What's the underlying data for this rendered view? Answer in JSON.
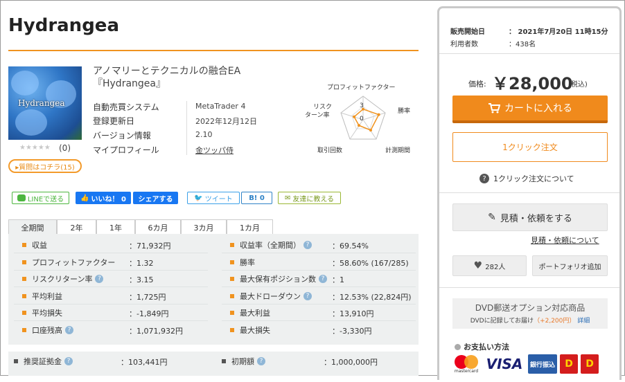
{
  "product": {
    "title": "Hydrangea",
    "thumb_label": "Hydrangea",
    "subtitle_line1": "アノマリーとテクニカルの融合EA",
    "subtitle_line2": "『Hydrangea』",
    "stars": "★★★★★",
    "rating_count": "(0)",
    "qa_button": "▸質問はコチラ(15)"
  },
  "specs": [
    {
      "label": "自動売買システム",
      "value": "MetaTrader 4"
    },
    {
      "label": "登録更新日",
      "value": "2022年12月12日"
    },
    {
      "label": "バージョン情報",
      "value": "2.10"
    },
    {
      "label": "マイプロフィール",
      "value": "金ツッパ侍"
    }
  ],
  "radar": {
    "labels": {
      "top": "プロフィットファクター",
      "left_1": "リスク",
      "left_2": "ターン率",
      "right": "勝率",
      "bottom_left": "取引回数",
      "bottom_right": "計測期間"
    },
    "scale_max": "3",
    "scale_min": "0",
    "values": [
      0.45,
      0.7,
      0.55,
      0.3,
      0.4
    ]
  },
  "social": {
    "line": "LINEで送る",
    "like": "いいね！ 0",
    "share": "シェアする",
    "tweet": "ツイート",
    "hatena": "B! 0",
    "friend": "友達に教える"
  },
  "tabs": [
    "全期間",
    "2年",
    "1年",
    "6カ月",
    "3カ月",
    "1カ月"
  ],
  "stats_left": [
    {
      "label": "収益",
      "value": "：71,932円",
      "help": false
    },
    {
      "label": "プロフィットファクター",
      "value": "：1.32",
      "help": false
    },
    {
      "label": "リスクリターン率",
      "value": "：3.15",
      "help": true
    },
    {
      "label": "平均利益",
      "value": "：1,725円",
      "help": false
    },
    {
      "label": "平均損失",
      "value": "：-1,849円",
      "help": false
    },
    {
      "label": "口座残高",
      "value": "：1,071,932円",
      "help": true
    }
  ],
  "stats_right": [
    {
      "label": "収益率（全期間）",
      "value": "：69.54%",
      "help": true
    },
    {
      "label": "勝率",
      "value": "：58.60% (167/285)",
      "help": false
    },
    {
      "label": "最大保有ポジション数",
      "value": "：1",
      "help": true
    },
    {
      "label": "最大ドローダウン",
      "value": "：12.53% (22,824円)",
      "help": true
    },
    {
      "label": "最大利益",
      "value": "：13,910円",
      "help": false
    },
    {
      "label": "最大損失",
      "value": "：-3,330円",
      "help": false
    }
  ],
  "stats2_left": {
    "label": "推奨証拠金",
    "value": "：103,441円"
  },
  "stats2_right": {
    "label": "初期額",
    "value": "：1,000,000円"
  },
  "sidebar": {
    "sale_start_label": "販売開始日",
    "sale_start_value": "：  2021年7月20日 11時15分",
    "users_label": "利用者数",
    "users_value": "：438名",
    "price_label": "価格:",
    "price": "￥28,000",
    "price_tax": "(税込)",
    "cart_button": "カートに入れる",
    "oneclick_button": "1クリック注文",
    "oneclick_about": "1クリック注文について",
    "estimate_button": "見積・依頼をする",
    "estimate_link": "見積・依頼について",
    "favorites": "282人",
    "portfolio": "ポートフォリオ追加",
    "dvd_title": "DVD郵送オプション対応商品",
    "dvd_sub_prefix": "DVDに記録してお届け",
    "dvd_sub_price": "（+2,200円）",
    "dvd_sub_link": "詳細",
    "payment_title": "お支払い方法",
    "pay_mastercard": "mastercard",
    "pay_visa": "VISA",
    "pay_bank": "銀行振込"
  },
  "colors": {
    "accent": "#f08a1c",
    "rule": "#f0931f",
    "stats_bg": "#eef0f0"
  }
}
